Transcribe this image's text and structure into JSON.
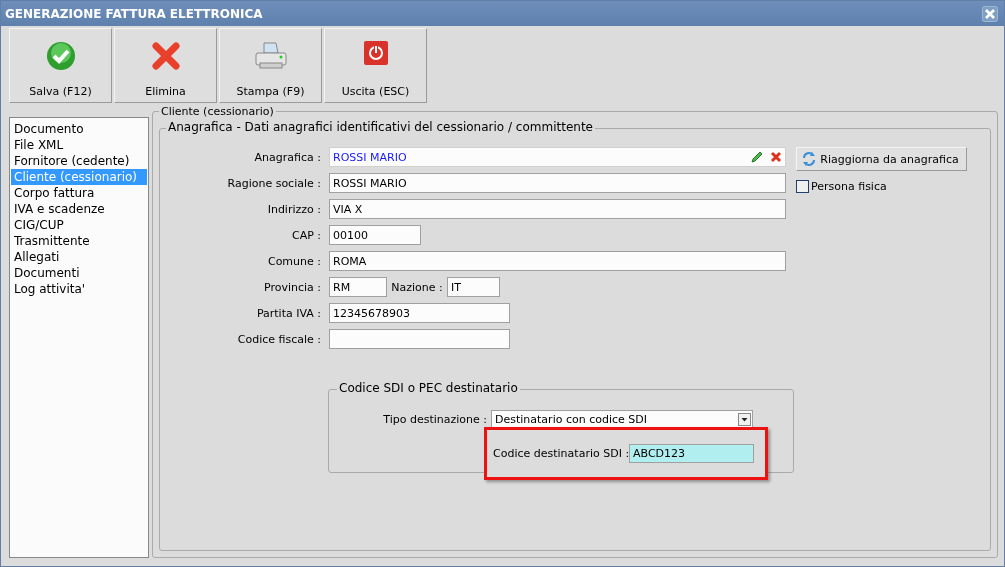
{
  "window": {
    "title": "GENERAZIONE FATTURA ELETTRONICA"
  },
  "toolbar": [
    {
      "label": "Salva (F12)",
      "kind": "save"
    },
    {
      "label": "Elimina",
      "kind": "delete"
    },
    {
      "label": "Stampa (F9)",
      "kind": "print"
    },
    {
      "label": "Uscita (ESC)",
      "kind": "exit"
    }
  ],
  "sidebar": {
    "items": [
      {
        "label": "Documento",
        "selected": false
      },
      {
        "label": "File XML",
        "selected": false
      },
      {
        "label": "Fornitore (cedente)",
        "selected": false
      },
      {
        "label": "Cliente (cessionario)",
        "selected": true
      },
      {
        "label": "Corpo fattura",
        "selected": false
      },
      {
        "label": "IVA e scadenze",
        "selected": false
      },
      {
        "label": "CIG/CUP",
        "selected": false
      },
      {
        "label": "Trasmittente",
        "selected": false
      },
      {
        "label": "Allegati",
        "selected": false
      },
      {
        "label": "Documenti",
        "selected": false
      },
      {
        "label": "Log attivita'",
        "selected": false
      }
    ]
  },
  "section": {
    "title": "Cliente (cessionario)",
    "group": {
      "title": "Anagrafica - Dati anagrafici identificativi del cessionario / committente",
      "rows": [
        {
          "kind": "lookup",
          "fields": [
            {
              "label": "Anagrafica :",
              "value": "ROSSI MARIO"
            }
          ]
        },
        {
          "kind": "long",
          "fields": [
            {
              "label": "Ragione sociale :",
              "value": "ROSSI MARIO"
            }
          ]
        },
        {
          "kind": "long",
          "fields": [
            {
              "label": "Indirizzo :",
              "value": "VIA X"
            }
          ]
        },
        {
          "kind": "short",
          "fields": [
            {
              "label": "CAP :",
              "value": "00100"
            }
          ]
        },
        {
          "kind": "long",
          "fields": [
            {
              "label": "Comune :",
              "value": "ROMA"
            }
          ]
        },
        {
          "kind": "pair",
          "fields": [
            {
              "label": "Provincia :",
              "value": "RM"
            },
            {
              "label": "Nazione :",
              "value": "IT"
            }
          ]
        },
        {
          "kind": "medium",
          "fields": [
            {
              "label": "Partita IVA :",
              "value": "12345678903"
            }
          ]
        },
        {
          "kind": "medium",
          "fields": [
            {
              "label": "Codice fiscale :"
            }
          ]
        }
      ],
      "refresh_button": "Riaggiorna da anagrafica",
      "persona_fisica": {
        "label": "Persona fisica",
        "checked": false
      }
    },
    "sdi": {
      "title": "Codice SDI o PEC destinatario",
      "tipo": {
        "label": "Tipo destinazione :",
        "value": "Destinatario con codice SDI"
      },
      "codice": {
        "label": "Codice destinatario SDI :",
        "value": "ABCD123"
      }
    }
  }
}
